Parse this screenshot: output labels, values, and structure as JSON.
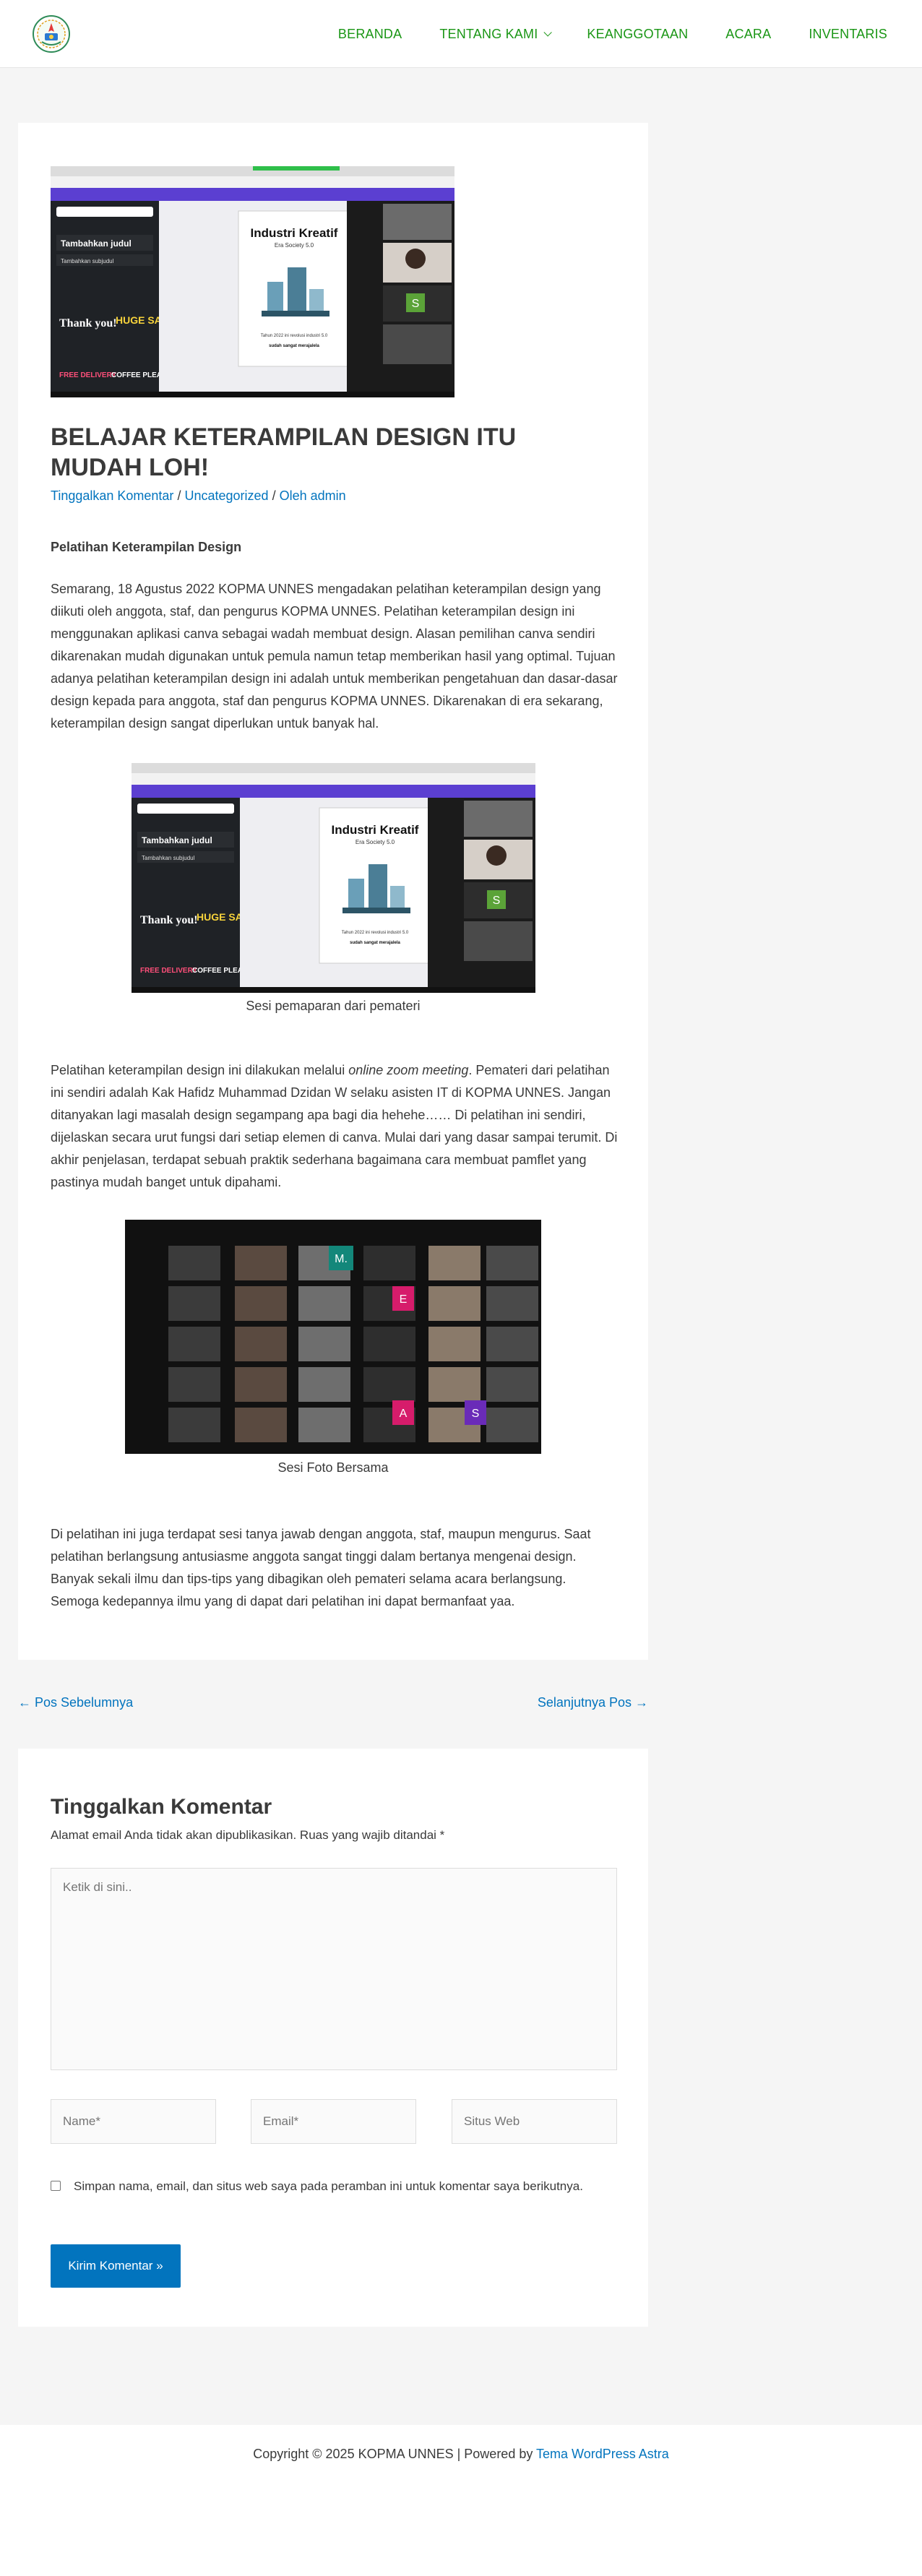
{
  "header": {
    "nav": [
      {
        "label": "BERANDA"
      },
      {
        "label": "TENTANG KAMI",
        "has_submenu": true
      },
      {
        "label": "KEANGGOTAAN"
      },
      {
        "label": "ACARA"
      },
      {
        "label": "INVENTARIS"
      }
    ],
    "brand_color": "#1a9615"
  },
  "article": {
    "title": "BELAJAR KETERAMPILAN DESIGN ITU MUDAH LOH!",
    "meta": {
      "comment_link": "Tinggalkan Komentar",
      "category": "Uncategorized",
      "author": "Oleh admin"
    },
    "subheading": "Pelatihan Keterampilan Design",
    "paragraph1": "Semarang, 18 Agustus 2022 KOPMA UNNES mengadakan pelatihan keterampilan design yang diikuti oleh anggota, staf, dan pengurus KOPMA UNNES. Pelatihan keterampilan design ini menggunakan aplikasi canva sebagai wadah membuat design. Alasan pemilihan canva sendiri dikarenakan mudah digunakan untuk pemula namun tetap memberikan hasil yang optimal. Tujuan adanya pelatihan keterampilan design ini adalah untuk memberikan pengetahuan dan dasar-dasar design kepada para anggota, staf dan pengurus KOPMA UNNES. Dikarenakan di era sekarang, keterampilan design sangat diperlukan untuk banyak hal.",
    "caption1": "Sesi pemaparan dari pemateri",
    "paragraph2_before": "Pelatihan keterampilan design ini dilakukan melalui ",
    "paragraph2_italic": "online zoom meeting",
    "paragraph2_after": ". Pemateri dari pelatihan ini sendiri adalah Kak Hafidz Muhammad Dzidan W selaku asisten IT di KOPMA UNNES. Jangan ditanyakan lagi masalah design segampang apa bagi dia hehehe…… Di pelatihan ini sendiri, dijelaskan secara urut fungsi dari setiap elemen di canva. Mulai dari yang dasar sampai terumit. Di akhir penjelasan, terdapat sebuah praktik sederhana bagaimana cara membuat pamflet yang pastinya mudah banget untuk dipahami.",
    "caption2": "Sesi Foto Bersama",
    "paragraph3": "Di pelatihan ini juga terdapat sesi tanya jawab dengan anggota, staf, maupun mengurus. Saat pelatihan berlangsung antusiasme anggota sangat tinggi dalam bertanya mengenai design. Banyak sekali ilmu dan tips-tips yang dibagikan oleh pemateri selama acara berlangsung. Semoga kedepannya ilmu yang di dapat dari pelatihan ini dapat bermanfaat yaa.",
    "slide": {
      "title": "Industri Kreatif",
      "subtitle": "Era Society 5.0",
      "footer1": "Tahun 2022 ini revolusi industri 5.0",
      "footer2": "sudah sangat merajalela",
      "sidebar_heading": "Tambahkan judul",
      "sidebar_sub": "Tambahkan subjudul",
      "sticker1": "Thank you!",
      "sticker2": "HUGE SALE",
      "sticker3": "FREE DELIVERY",
      "sticker4": "COFFEE PLEASE",
      "tile_letter": "S"
    },
    "gallery_letters": [
      "M.",
      "E",
      "A",
      "S"
    ]
  },
  "post_nav": {
    "prev": "← Pos Sebelumnya",
    "next": "Selanjutnya Pos →"
  },
  "comment_form": {
    "title": "Tinggalkan Komentar",
    "notes": "Alamat email Anda tidak akan dipublikasikan. Ruas yang wajib ditandai *",
    "comment_placeholder": "Ketik di sini..",
    "name_placeholder": "Name*",
    "email_placeholder": "Email*",
    "website_placeholder": "Situs Web",
    "cookies_label": "Simpan nama, email, dan situs web saya pada peramban ini untuk komentar saya berikutnya.",
    "submit_label": "Kirim Komentar »"
  },
  "footer": {
    "copyright": "Copyright © 2025 KOPMA UNNES | Powered by ",
    "theme_link": "Tema WordPress Astra"
  }
}
